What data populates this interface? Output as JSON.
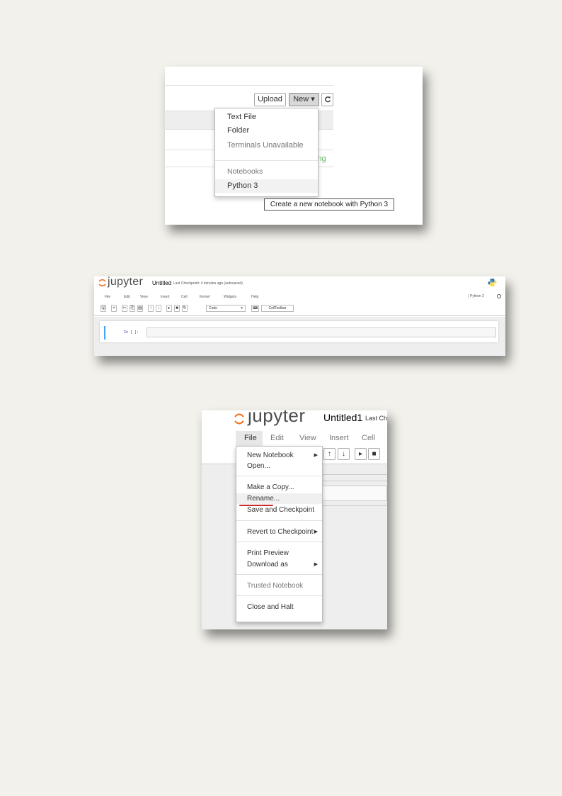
{
  "colors": {
    "accent_orange": "#f37726",
    "running_green": "#5cb85c",
    "cell_blue": "#42a5f5",
    "rename_underline": "#c72c2c"
  },
  "panel1": {
    "toolbar": {
      "upload": "Upload",
      "new": "New ▾",
      "refresh_icon": "refresh-icon"
    },
    "status_running_fragment": "ing",
    "new_menu": {
      "items": [
        {
          "label": "Text File",
          "disabled": false
        },
        {
          "label": "Folder",
          "disabled": false
        },
        {
          "label": "Terminals Unavailable",
          "disabled": true
        }
      ],
      "section_header": "Notebooks",
      "kernel_item": "Python 3"
    },
    "tooltip": "Create a new notebook with Python 3"
  },
  "panel2": {
    "logo": "jupyter",
    "notebook_name": "Untitled",
    "checkpoint": "Last Checkpoint: 4 minutes ago (autosaved)",
    "menu": [
      "File",
      "Edit",
      "View",
      "Insert",
      "Cell",
      "Kernel",
      "Widgets",
      "Help"
    ],
    "kernel": "Python 3",
    "cell_type": "Code",
    "celltoolbar": "CellToolbar",
    "prompt": "In [ ]:"
  },
  "panel3": {
    "logo": "jupyter",
    "notebook_name": "Untitled1",
    "checkpoint_fragment": "Last Chec",
    "menu": [
      "File",
      "Edit",
      "View",
      "Insert",
      "Cell"
    ],
    "file_menu": [
      {
        "label": "New Notebook",
        "submenu": true
      },
      {
        "label": "Open..."
      },
      {
        "label": "Make a Copy..."
      },
      {
        "label": "Rename..."
      },
      {
        "label": "Save and Checkpoint"
      },
      {
        "label": "Revert to Checkpoint",
        "submenu": true
      },
      {
        "label": "Print Preview"
      },
      {
        "label": "Download as",
        "submenu": true
      },
      {
        "label": "Trusted Notebook",
        "disabled": true
      },
      {
        "label": "Close and Halt"
      }
    ]
  }
}
